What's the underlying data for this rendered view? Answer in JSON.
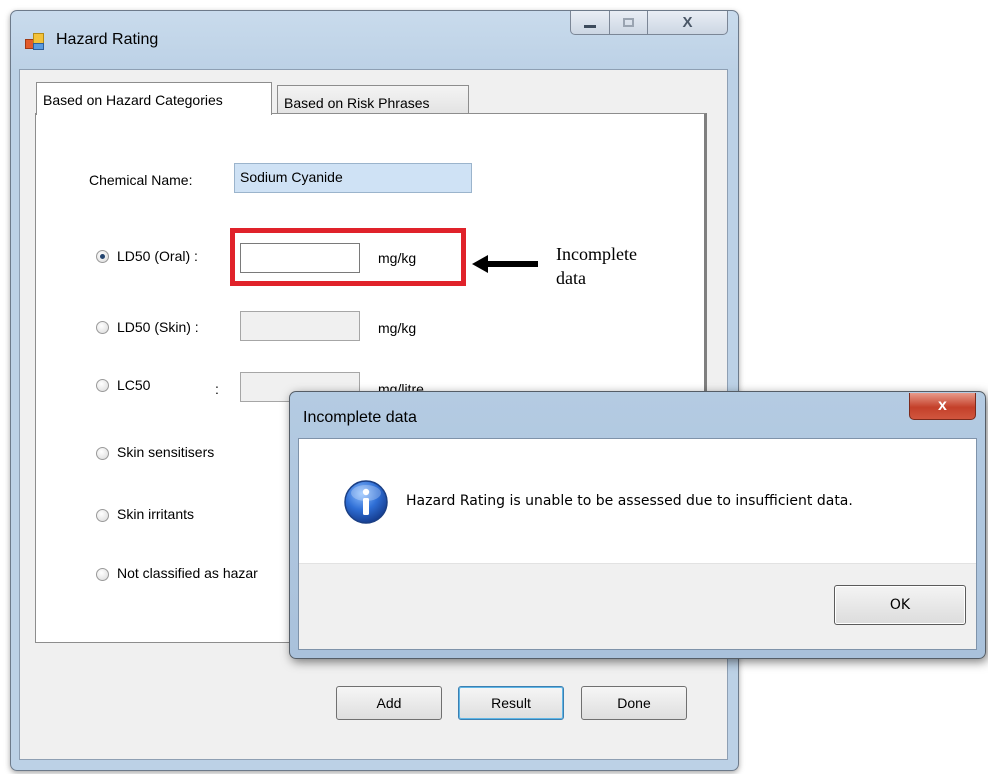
{
  "main_window": {
    "title": "Hazard Rating",
    "tabs": [
      {
        "label": "Based on Hazard Categories",
        "active": true
      },
      {
        "label": "Based on Risk Phrases",
        "active": false
      }
    ],
    "chemical_name_label": "Chemical Name:",
    "chemical_name_value": "Sodium Cyanide",
    "options": [
      {
        "label": "LD50 (Oral) :",
        "unit": "mg/kg",
        "checked": true,
        "value": ""
      },
      {
        "label": "LD50 (Skin) :",
        "unit": "mg/kg",
        "checked": false,
        "value": ""
      },
      {
        "label": "LC50",
        "colon": ":",
        "unit": "mg/litre",
        "checked": false,
        "value": ""
      },
      {
        "label": "Skin sensitisers",
        "checked": false
      },
      {
        "label": "Skin irritants",
        "checked": false
      },
      {
        "label": "Not classified as hazar",
        "checked": false
      }
    ],
    "buttons": {
      "add": "Add",
      "result": "Result",
      "done": "Done"
    },
    "caption_close": "X"
  },
  "annotation": {
    "line1": "Incomplete",
    "line2": "data",
    "highlight_color": "#e0222a"
  },
  "dialog": {
    "title": "Incomplete data",
    "message": "Hazard Rating is unable to be assessed due to insufficient data.",
    "ok_label": "OK",
    "close_label": "x",
    "icon": "info-icon"
  }
}
